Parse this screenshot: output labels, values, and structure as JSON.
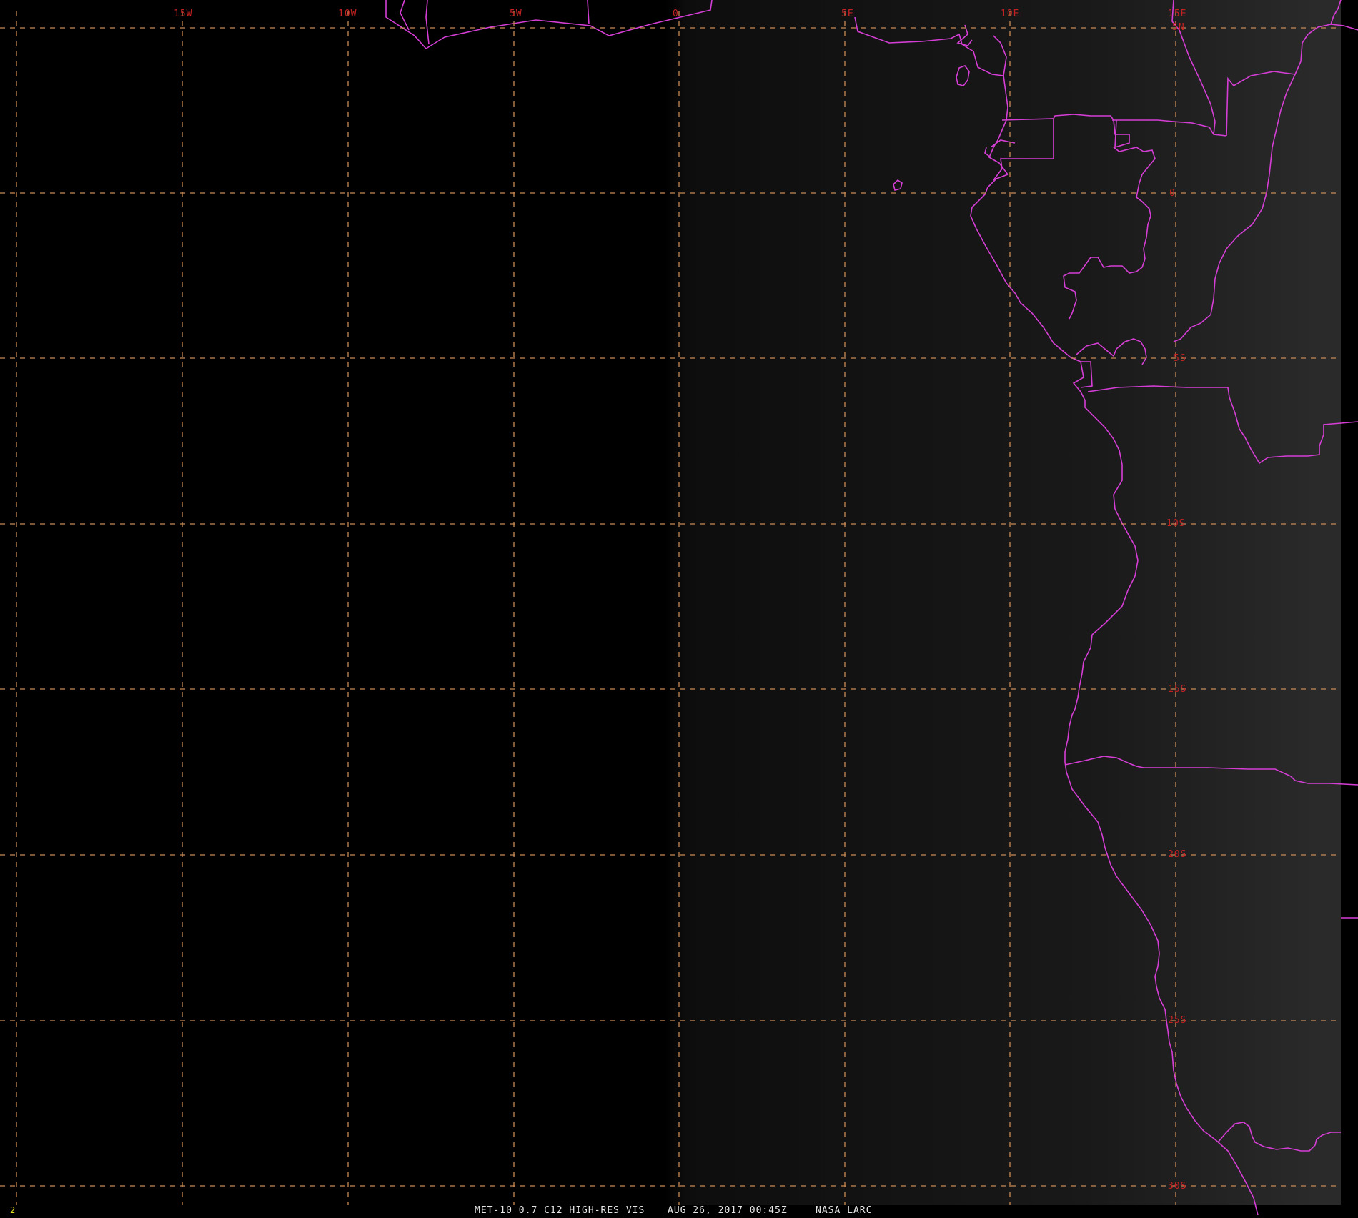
{
  "map": {
    "frame_number": "2",
    "footer": {
      "product": "MET-10 0.7 C12 HIGH-RES VIS",
      "datetime": "AUG 26, 2017 00:45Z",
      "source": "NASA LARC"
    },
    "longitude_labels": [
      "15W",
      "10W",
      "5W",
      "0",
      "5E",
      "10E",
      "15E"
    ],
    "latitude_labels": [
      "5N",
      "0",
      "5S",
      "10S",
      "15S",
      "20S",
      "25S",
      "30S"
    ],
    "colors": {
      "background_dark": "#000000",
      "background_light": "#2b2b2b",
      "coastline": "#d53ed5",
      "gridline": "#c88a55",
      "grid_label": "#c42222",
      "footer_text": "#e6e6e6",
      "frame_number": "#e0e020"
    },
    "image_type": "satellite visible channel with lat/lon grid overlay"
  }
}
